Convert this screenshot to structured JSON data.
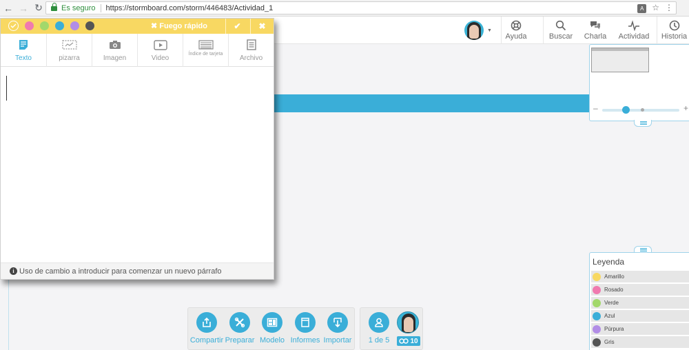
{
  "browser": {
    "secure_label": "Es seguro",
    "url": "https://stormboard.com/storm/446483/Actividad_1"
  },
  "topbar": {
    "tools": [
      {
        "label": "Ayuda",
        "icon": "lifebuoy-icon"
      },
      {
        "label": "Buscar",
        "icon": "search-icon"
      },
      {
        "label": "Charla",
        "icon": "chat-icon"
      },
      {
        "label": "Actividad",
        "icon": "activity-icon"
      },
      {
        "label": "Historia",
        "icon": "clock-icon"
      }
    ]
  },
  "editor": {
    "mode_label": "Fuego rápido",
    "colors": [
      "#f8d862",
      "#f07aaf",
      "#a3d86b",
      "#3aaed8",
      "#b28de6",
      "#555555"
    ],
    "tabs": [
      {
        "label": "Texto",
        "active": true
      },
      {
        "label": "pizarra"
      },
      {
        "label": "Imagen"
      },
      {
        "label": "Video"
      },
      {
        "label": "Índice de tarjeta"
      },
      {
        "label": "Archivo"
      }
    ],
    "footer_hint": "Uso de cambio a introducir para comenzar un nuevo párrafo"
  },
  "legend": {
    "title": "Leyenda",
    "items": [
      {
        "label": "Amarillo",
        "color": "#f8d862"
      },
      {
        "label": "Rosado",
        "color": "#f07aaf"
      },
      {
        "label": "Verde",
        "color": "#a3d86b"
      },
      {
        "label": "Azul",
        "color": "#3aaed8"
      },
      {
        "label": "Púrpura",
        "color": "#b28de6"
      },
      {
        "label": "Gris",
        "color": "#555555"
      }
    ]
  },
  "bottom_toolbar": {
    "items": [
      {
        "label": "Compartir",
        "icon": "share-icon"
      },
      {
        "label": "Preparar",
        "icon": "tools-icon"
      },
      {
        "label": "Modelo",
        "icon": "template-icon"
      },
      {
        "label": "Informes",
        "icon": "reports-icon"
      },
      {
        "label": "Importar",
        "icon": "import-icon"
      }
    ]
  },
  "users": {
    "pager": "1 de 5",
    "badge": "10"
  },
  "accent_color": "#3aaed8"
}
